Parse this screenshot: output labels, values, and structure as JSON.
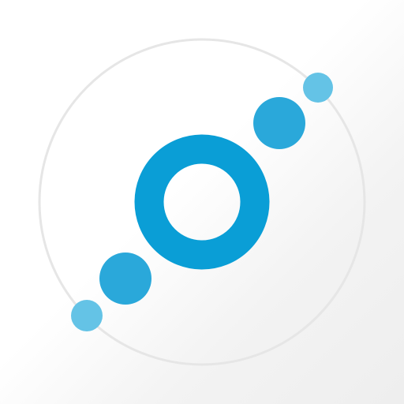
{
  "app_icon": {
    "icon_name": "orbit-dots-logo-icon",
    "colors": {
      "ring_outline": "#e6e6e6",
      "center_ring": "#0a9ed6",
      "large_dots": "#2aa8da",
      "small_dots": "#64c3e6",
      "background_light": "#ffffff",
      "background_shade": "#eeeeee"
    }
  }
}
